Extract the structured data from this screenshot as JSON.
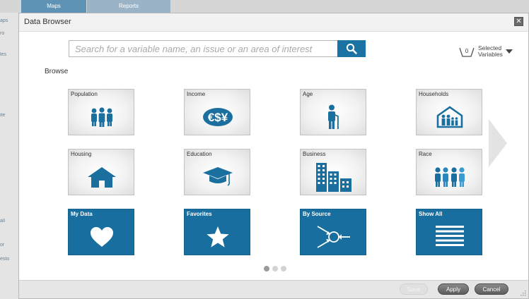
{
  "background": {
    "tabs": [
      "Maps",
      "Reports"
    ],
    "side_fragments": [
      "aps",
      "ro",
      "les",
      "ite",
      "all",
      "or",
      "esto"
    ]
  },
  "modal": {
    "title": "Data Browser",
    "close_icon": "close-icon"
  },
  "search": {
    "placeholder": "Search for a variable name, an issue or an area of interest",
    "value": "",
    "icon": "search-icon"
  },
  "selected_variables": {
    "count": "0",
    "label": "Selected Variables"
  },
  "browse": {
    "label": "Browse",
    "tiles": [
      {
        "label": "Population",
        "icon": "population-icon",
        "style": "light"
      },
      {
        "label": "Income",
        "icon": "income-icon",
        "style": "light"
      },
      {
        "label": "Age",
        "icon": "age-icon",
        "style": "light"
      },
      {
        "label": "Households",
        "icon": "households-icon",
        "style": "light"
      },
      {
        "label": "Housing",
        "icon": "housing-icon",
        "style": "light"
      },
      {
        "label": "Education",
        "icon": "education-icon",
        "style": "light"
      },
      {
        "label": "Business",
        "icon": "business-icon",
        "style": "light"
      },
      {
        "label": "Race",
        "icon": "race-icon",
        "style": "light"
      },
      {
        "label": "My Data",
        "icon": "heart-icon",
        "style": "dark"
      },
      {
        "label": "Favorites",
        "icon": "star-icon",
        "style": "dark"
      },
      {
        "label": "By Source",
        "icon": "source-icon",
        "style": "dark"
      },
      {
        "label": "Show All",
        "icon": "list-icon",
        "style": "dark"
      }
    ]
  },
  "pagination": {
    "pages": 3,
    "current": 1
  },
  "footer": {
    "save": "Save",
    "apply": "Apply",
    "cancel": "Cancel"
  },
  "colors": {
    "accent": "#1b73a3",
    "dark_tile": "#186f9f",
    "icon": "#1b6f9f"
  }
}
